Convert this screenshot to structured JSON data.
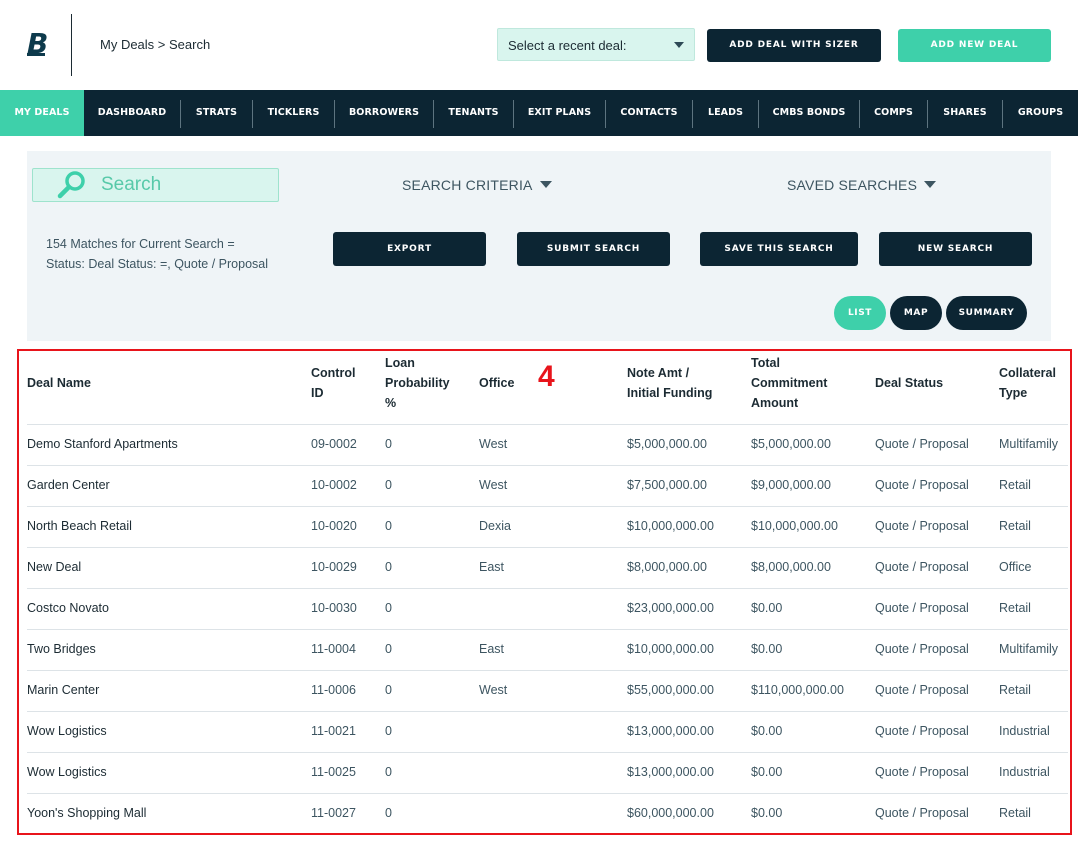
{
  "header": {
    "logo_letter": "B",
    "breadcrumb": "My Deals > Search",
    "recent_select": "Select a recent deal:",
    "add_with_sizer": "ADD DEAL WITH SIZER",
    "add_new": "ADD NEW DEAL"
  },
  "nav": [
    {
      "label": "MY DEALS",
      "active": true
    },
    {
      "label": "DASHBOARD"
    },
    {
      "label": "STRATS"
    },
    {
      "label": "TICKLERS"
    },
    {
      "label": "BORROWERS"
    },
    {
      "label": "TENANTS"
    },
    {
      "label": "EXIT PLANS"
    },
    {
      "label": "CONTACTS"
    },
    {
      "label": "LEADS"
    },
    {
      "label": "CMBS BONDS"
    },
    {
      "label": "COMPS"
    },
    {
      "label": "SHARES"
    },
    {
      "label": "GROUPS"
    }
  ],
  "search": {
    "label": "Search",
    "criteria": "SEARCH CRITERIA",
    "saved": "SAVED SEARCHES",
    "matches_line1": "154 Matches for Current Search =",
    "matches_line2": "Status:  Deal Status: =, Quote / Proposal",
    "export": "EXPORT",
    "submit": "SUBMIT SEARCH",
    "save": "SAVE THIS SEARCH",
    "new": "NEW SEARCH",
    "view_list": "LIST",
    "view_map": "MAP",
    "view_summary": "SUMMARY"
  },
  "marker": "4",
  "table": {
    "headers": [
      [
        "Deal Name"
      ],
      [
        "Control",
        "ID"
      ],
      [
        "Loan",
        "Probability",
        "%"
      ],
      [
        "Office"
      ],
      [
        "Note Amt /",
        "Initial Funding"
      ],
      [
        "Total",
        "Commitment",
        "Amount"
      ],
      [
        "Deal Status"
      ],
      [
        "Collateral",
        "Type"
      ]
    ],
    "rows": [
      [
        "Demo Stanford Apartments",
        "09-0002",
        "0",
        "West",
        "$5,000,000.00",
        "$5,000,000.00",
        "Quote / Proposal",
        "Multifamily"
      ],
      [
        "Garden Center",
        "10-0002",
        "0",
        "West",
        "$7,500,000.00",
        "$9,000,000.00",
        "Quote / Proposal",
        "Retail"
      ],
      [
        "North Beach Retail",
        "10-0020",
        "0",
        "Dexia",
        "$10,000,000.00",
        "$10,000,000.00",
        "Quote / Proposal",
        "Retail"
      ],
      [
        "New Deal",
        "10-0029",
        "0",
        "East",
        "$8,000,000.00",
        "$8,000,000.00",
        "Quote / Proposal",
        "Office"
      ],
      [
        "Costco Novato",
        "10-0030",
        "0",
        "",
        "$23,000,000.00",
        "$0.00",
        "Quote / Proposal",
        "Retail"
      ],
      [
        "Two Bridges",
        "11-0004",
        "0",
        "East",
        "$10,000,000.00",
        "$0.00",
        "Quote / Proposal",
        "Multifamily"
      ],
      [
        "Marin Center",
        "11-0006",
        "0",
        "West",
        "$55,000,000.00",
        "$110,000,000.00",
        "Quote / Proposal",
        "Retail"
      ],
      [
        "Wow Logistics",
        "11-0021",
        "0",
        "",
        "$13,000,000.00",
        "$0.00",
        "Quote / Proposal",
        "Industrial"
      ],
      [
        "Wow Logistics",
        "11-0025",
        "0",
        "",
        "$13,000,000.00",
        "$0.00",
        "Quote / Proposal",
        "Industrial"
      ],
      [
        "Yoon's Shopping Mall",
        "11-0027",
        "0",
        "",
        "$60,000,000.00",
        "$0.00",
        "Quote / Proposal",
        "Retail"
      ]
    ]
  },
  "colors": {
    "navy": "#0c2533",
    "teal": "#3ed0aa",
    "mint": "#d9f5ee",
    "panel": "#eff4f7",
    "highlight": "#e8141b"
  }
}
